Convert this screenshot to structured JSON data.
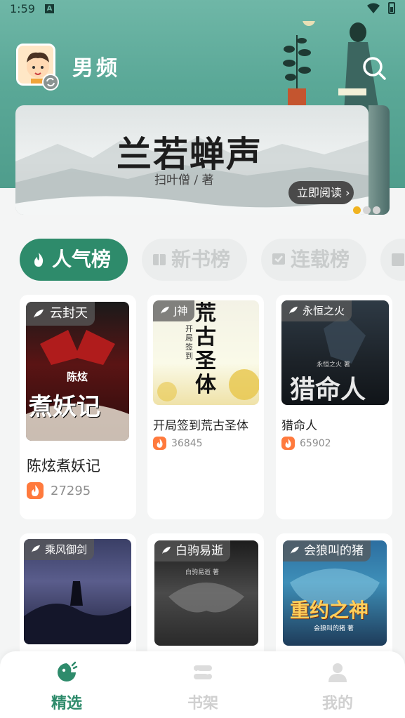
{
  "status": {
    "time": "1:59",
    "notif_icon": "A"
  },
  "header": {
    "channel": "男频",
    "search_icon": "search-icon"
  },
  "banner": {
    "title": "兰若蝉声",
    "subtitle": "扫叶僧 / 著",
    "cta": "立即阅读 ›",
    "dot_active_color": "#f0b320",
    "dot_inactive_color": "#d5d5d5"
  },
  "tabs": [
    {
      "label": "人气榜",
      "active": true
    },
    {
      "label": "新书榜",
      "active": false
    },
    {
      "label": "连载榜",
      "active": false
    }
  ],
  "books": [
    {
      "title": "陈炫煮妖记",
      "author": "云封天",
      "heat": "27295",
      "cover_text": "煮妖记",
      "cover_small": "陈炫"
    },
    {
      "title": "开局签到荒古圣体",
      "author": "J神",
      "heat": "36845",
      "cover_text": "荒古圣体",
      "cover_small": "开局签到"
    },
    {
      "title": "猎命人",
      "author": "永恒之火",
      "heat": "65902",
      "cover_text": "猎命人",
      "cover_small": "永恒之火 著"
    },
    {
      "title": "",
      "author": "乘风御剑",
      "heat": "",
      "cover_text": "",
      "cover_small": ""
    },
    {
      "title": "",
      "author": "白驹易逝",
      "heat": "",
      "cover_text": "",
      "cover_small": "白驹易逝 著"
    },
    {
      "title": "",
      "author": "会狼叫的猪",
      "heat": "",
      "cover_text": "重约之神",
      "cover_small": "会狼叫的猪 著"
    }
  ],
  "nav": [
    {
      "label": "精选",
      "active": true,
      "icon": "featured-icon"
    },
    {
      "label": "书架",
      "active": false,
      "icon": "bookshelf-icon"
    },
    {
      "label": "我的",
      "active": false,
      "icon": "profile-icon"
    }
  ],
  "colors": {
    "accent": "#2e8b6b",
    "header": "#5aa897",
    "fire": "#ff7a3d"
  }
}
